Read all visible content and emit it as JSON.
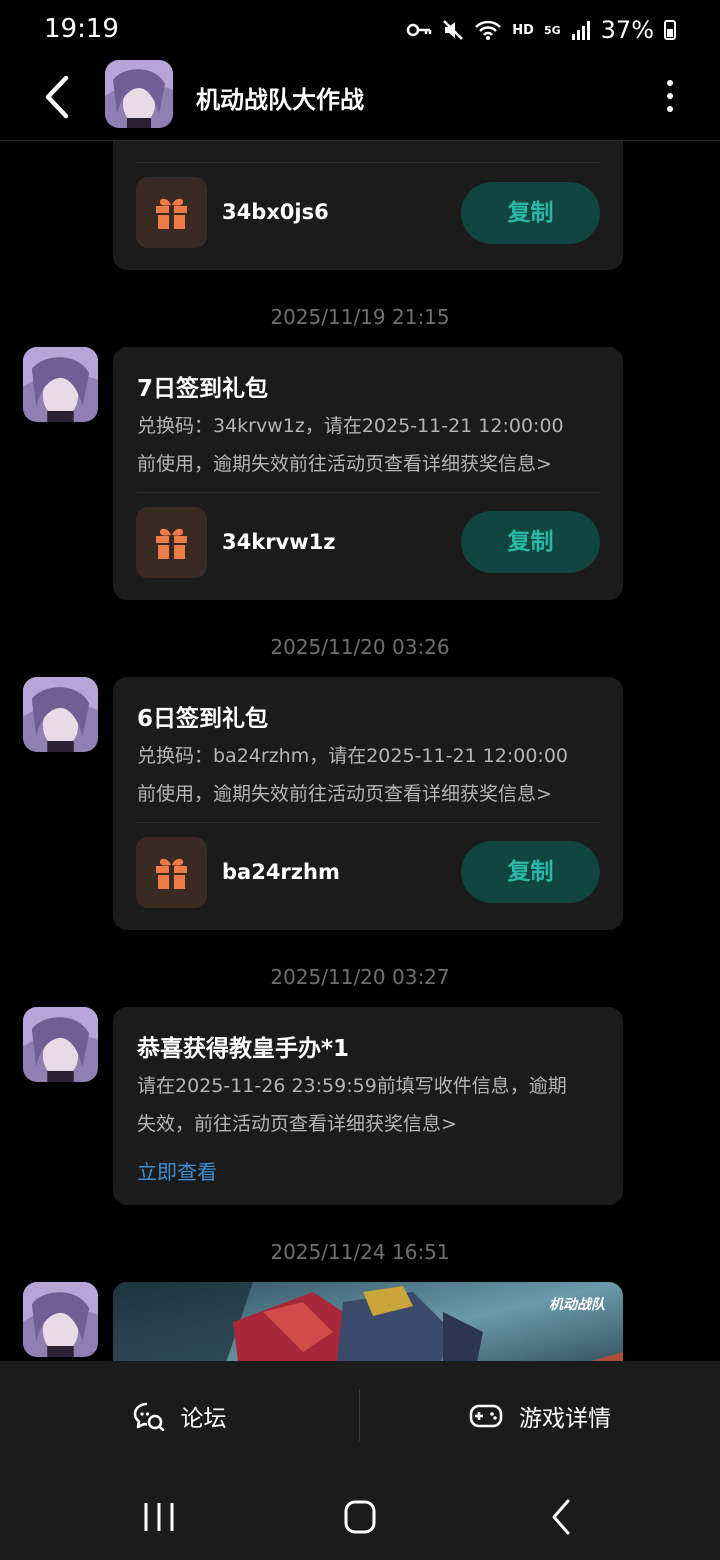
{
  "status_bar": {
    "time": "19:19",
    "hd": "HD",
    "network": "5G",
    "battery": "37%"
  },
  "header": {
    "title": "机动战队大作战"
  },
  "messages": {
    "m0": {
      "code": "34bx0js6",
      "copy_label": "复制"
    },
    "m1": {
      "timestamp": "2025/11/19  21:15",
      "title": "7日签到礼包",
      "body_line1": "兑换码：34krvw1z，请在2025-11-21 12:00:00",
      "body_line2": "前使用，逾期失效前往活动页查看详细获奖信息>",
      "code": "34krvw1z",
      "copy_label": "复制"
    },
    "m2": {
      "timestamp": "2025/11/20  03:26",
      "title": "6日签到礼包",
      "body_line1": "兑换码：ba24rzhm，请在2025-11-21 12:00:00",
      "body_line2": "前使用，逾期失效前往活动页查看详细获奖信息>",
      "code": "ba24rzhm",
      "copy_label": "复制"
    },
    "m3": {
      "timestamp": "2025/11/20  03:27",
      "title": "恭喜获得教皇手办*1",
      "body_line1": "请在2025-11-26 23:59:59前填写收件信息，逾期",
      "body_line2": "失效，前往活动页查看详细获奖信息>",
      "link": "立即查看"
    },
    "m4": {
      "timestamp": "2025/11/24  16:51",
      "banner_logo": "机动战队"
    }
  },
  "bottom_tabs": {
    "forum": "论坛",
    "game_details": "游戏详情"
  },
  "colors": {
    "accent_teal": "#2ab9a6",
    "gift_orange": "#ee7a45",
    "link_blue": "#3e8fd1"
  }
}
